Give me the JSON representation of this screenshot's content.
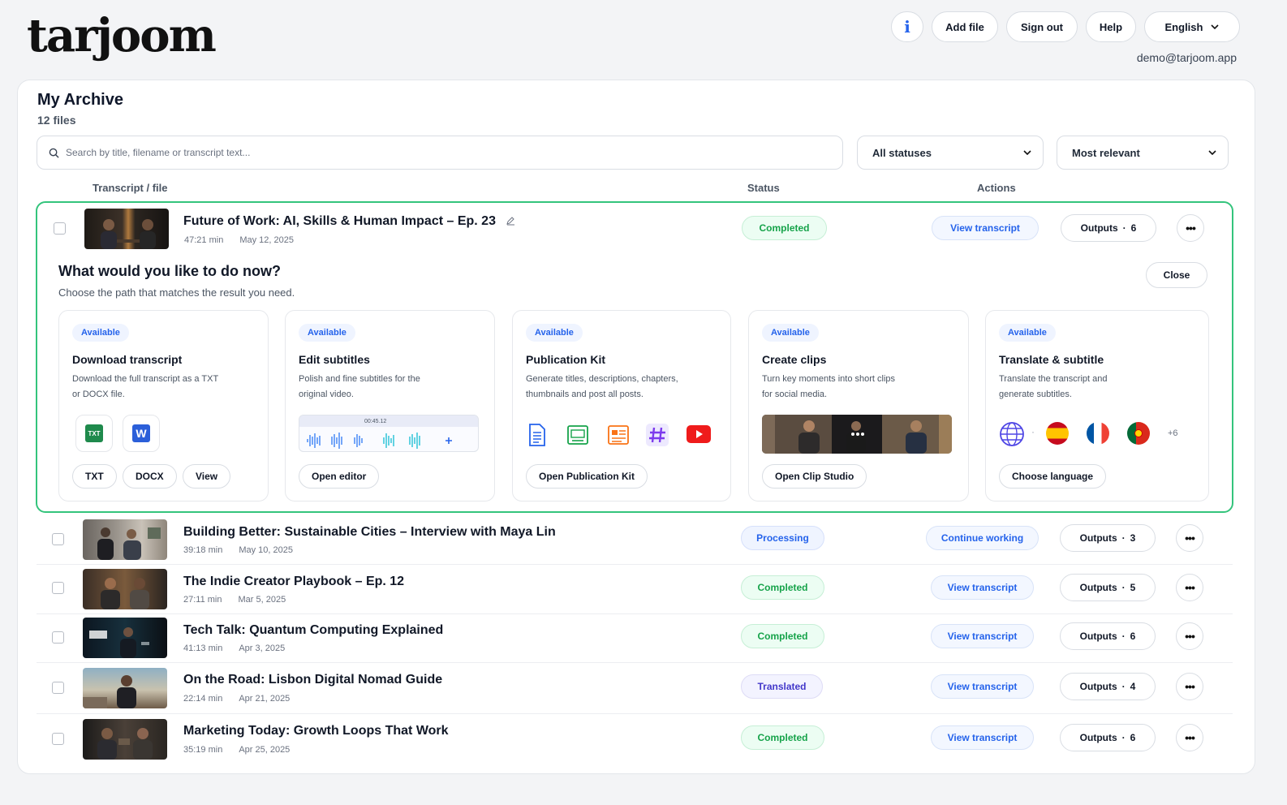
{
  "brand": {
    "logo": "tarjoom"
  },
  "topbar": {
    "info": "i",
    "add_file": "Add file",
    "sign_out": "Sign out",
    "help": "Help",
    "language": "English",
    "email": "demo@tarjoom.app"
  },
  "archive": {
    "title": "My Archive",
    "count": "12 files",
    "search_placeholder": "Search by title, filename or transcript text...",
    "status_filter": "All statuses",
    "sort": "Most relevant",
    "columns": {
      "file": "Transcript / file",
      "status": "Status",
      "actions": "Actions"
    }
  },
  "rows": [
    {
      "title": "Future of Work: AI, Skills & Human Impact – Ep. 23",
      "duration": "47:21 min",
      "date": "May 12, 2025",
      "status": "Completed",
      "action": "View transcript",
      "outputs_label": "Outputs",
      "outputs": "6"
    },
    {
      "title": "Building Better: Sustainable Cities – Interview with Maya Lin",
      "duration": "39:18 min",
      "date": "May 10, 2025",
      "status": "Processing",
      "action": "Continue working",
      "outputs_label": "Outputs",
      "outputs": "3"
    },
    {
      "title": "The Indie Creator Playbook – Ep. 12",
      "duration": "27:11 min",
      "date": "Mar 5, 2025",
      "status": "Completed",
      "action": "View transcript",
      "outputs_label": "Outputs",
      "outputs": "5"
    },
    {
      "title": "Tech Talk: Quantum Computing Explained",
      "duration": "41:13 min",
      "date": "Apr 3, 2025",
      "status": "Completed",
      "action": "View transcript",
      "outputs_label": "Outputs",
      "outputs": "6"
    },
    {
      "title": "On the Road: Lisbon Digital Nomad Guide",
      "duration": "22:14 min",
      "date": "Apr 21, 2025",
      "status": "Translated",
      "action": "View transcript",
      "outputs_label": "Outputs",
      "outputs": "4"
    },
    {
      "title": "Marketing Today: Growth Loops That Work",
      "duration": "35:19 min",
      "date": "Apr 25, 2025",
      "status": "Completed",
      "action": "View transcript",
      "outputs_label": "Outputs",
      "outputs": "6"
    }
  ],
  "panel": {
    "title": "What would you like to do now?",
    "subtitle": "Choose the path that matches the result you need.",
    "close": "Close",
    "options": [
      {
        "badge": "Available",
        "title": "Download transcript",
        "desc1": "Download the full transcript as a TXT",
        "desc2": "or DOCX file.",
        "buttons": [
          "TXT",
          "DOCX",
          "View"
        ],
        "icons": {
          "txt": "TXT",
          "docx": "W"
        }
      },
      {
        "badge": "Available",
        "title": "Edit subtitles",
        "desc1": "Polish and fine subtitles for the",
        "desc2": "original video.",
        "buttons": [
          "Open editor"
        ],
        "timecode": "00:45.12"
      },
      {
        "badge": "Available",
        "title": "Publication Kit",
        "desc1": "Generate titles, descriptions, chapters,",
        "desc2": "thumbnails and post all posts.",
        "buttons": [
          "Open Publication Kit"
        ]
      },
      {
        "badge": "Available",
        "title": "Create clips",
        "desc1": "Turn key moments into short clips",
        "desc2": "for social media.",
        "buttons": [
          "Open Clip Studio"
        ]
      },
      {
        "badge": "Available",
        "title": "Translate & subtitle",
        "desc1": "Translate the transcript and",
        "desc2": "generate subtitles.",
        "buttons": [
          "Choose language"
        ],
        "more_languages": "+6"
      }
    ]
  },
  "colors": {
    "accent": "#2563eb",
    "success": "#16a34a",
    "highlight_border": "#34c47c"
  }
}
